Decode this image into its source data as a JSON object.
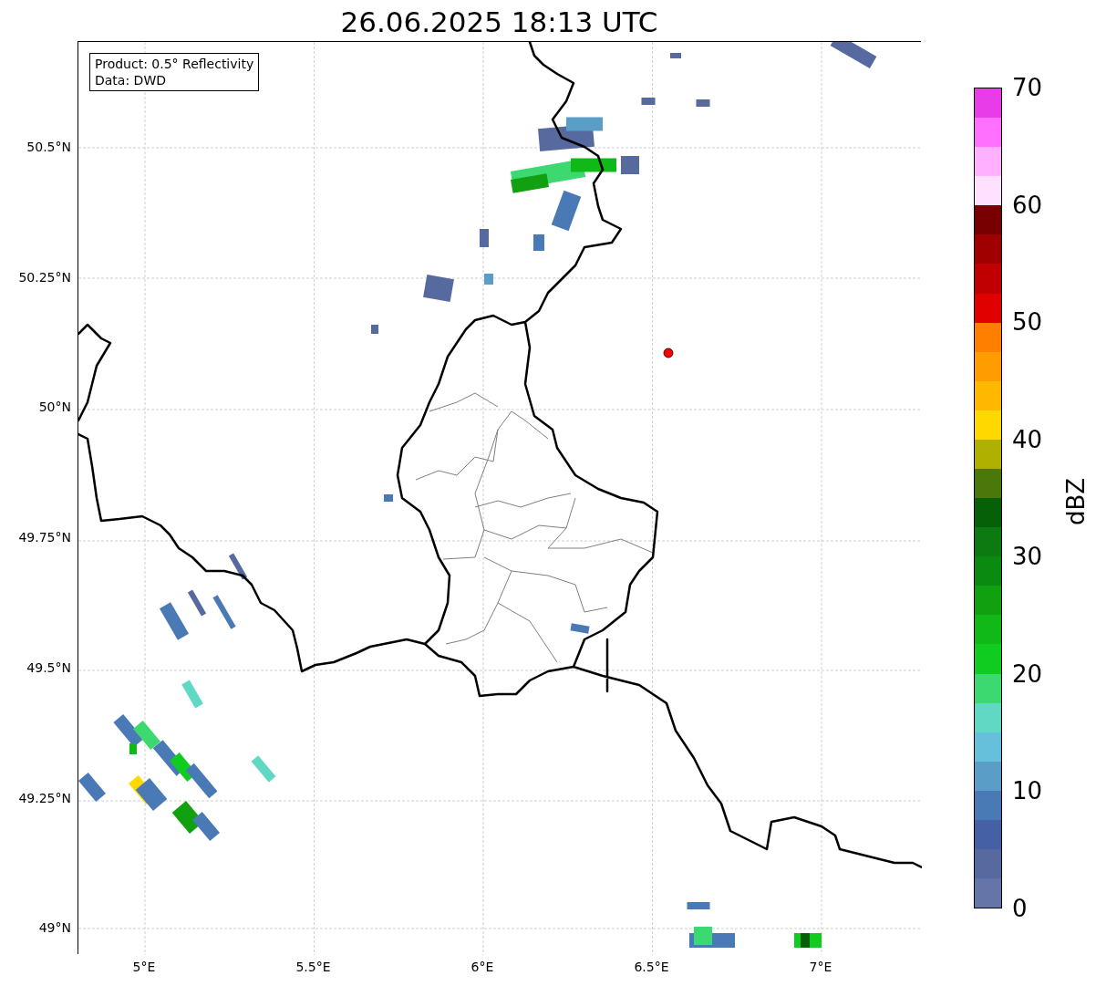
{
  "title": "26.06.2025 18:13 UTC",
  "legend": [
    "Product: 0.5° Reflectivity",
    "Data: DWD"
  ],
  "map": {
    "y_ticks": [
      "50.5°N",
      "50.25°N",
      "50°N",
      "49.75°N",
      "49.5°N",
      "49.25°N",
      "49°N"
    ],
    "x_ticks": [
      "5°E",
      "5.5°E",
      "6°E",
      "6.5°E",
      "7°E"
    ]
  },
  "colorbar": {
    "label": "dBZ",
    "ticks": [
      "70",
      "60",
      "50",
      "40",
      "30",
      "20",
      "10",
      "0"
    ],
    "segments": [
      {
        "color": "#e83ce8"
      },
      {
        "color": "#ff70ff"
      },
      {
        "color": "#ffb0ff"
      },
      {
        "color": "#ffe0ff"
      },
      {
        "color": "#780000"
      },
      {
        "color": "#a00000"
      },
      {
        "color": "#c00000"
      },
      {
        "color": "#e00000"
      },
      {
        "color": "#ff7f00"
      },
      {
        "color": "#ff9c00"
      },
      {
        "color": "#ffb800"
      },
      {
        "color": "#ffd800"
      },
      {
        "color": "#b0b000"
      },
      {
        "color": "#4a780a"
      },
      {
        "color": "#066008"
      },
      {
        "color": "#0c7a10"
      },
      {
        "color": "#0a8a10"
      },
      {
        "color": "#10a010"
      },
      {
        "color": "#10b818"
      },
      {
        "color": "#10cc20"
      },
      {
        "color": "#3cd870"
      },
      {
        "color": "#60d8c4"
      },
      {
        "color": "#66c0dc"
      },
      {
        "color": "#5a9ec8"
      },
      {
        "color": "#4a7ab5"
      },
      {
        "color": "#4560a5"
      },
      {
        "color": "#566aa0"
      },
      {
        "color": "#6675a8"
      }
    ]
  }
}
